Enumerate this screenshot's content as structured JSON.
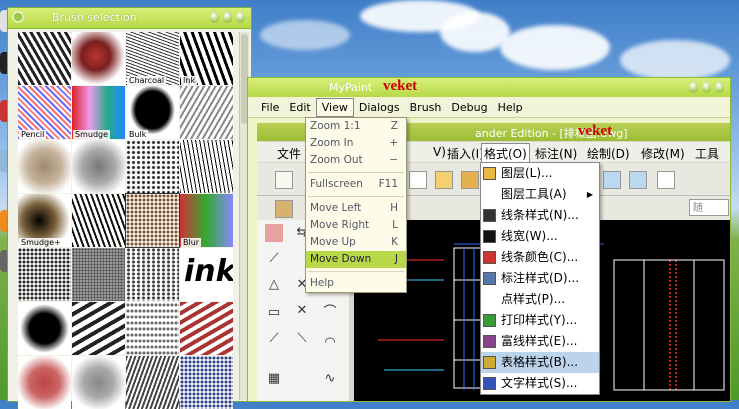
{
  "brush_window": {
    "title": "Brush selection",
    "brushes": [
      {
        "label": ""
      },
      {
        "label": ""
      },
      {
        "label": "Charcoal"
      },
      {
        "label": "Ink"
      },
      {
        "label": "Pencil"
      },
      {
        "label": "Smudge"
      },
      {
        "label": "Bulk"
      },
      {
        "label": ""
      },
      {
        "label": ""
      },
      {
        "label": ""
      },
      {
        "label": ""
      },
      {
        "label": ""
      },
      {
        "label": "Smudge+"
      },
      {
        "label": ""
      },
      {
        "label": ""
      },
      {
        "label": "Blur"
      },
      {
        "label": ""
      },
      {
        "label": ""
      },
      {
        "label": ""
      },
      {
        "label": ""
      },
      {
        "label": ""
      },
      {
        "label": ""
      },
      {
        "label": ""
      },
      {
        "label": ""
      },
      {
        "label": ""
      },
      {
        "label": ""
      },
      {
        "label": ""
      },
      {
        "label": ""
      }
    ],
    "ink_text": "ink",
    "accent": "#b6d946"
  },
  "mypaint": {
    "title": "MyPaint",
    "menu": [
      "File",
      "Edit",
      "View",
      "Dialogs",
      "Brush",
      "Debug",
      "Help"
    ],
    "active_menu": "View",
    "view_menu": [
      {
        "label": "Zoom 1:1",
        "key": "Z"
      },
      {
        "label": "Zoom In",
        "key": "+"
      },
      {
        "label": "Zoom Out",
        "key": "−"
      },
      {
        "sep": true
      },
      {
        "label": "Fullscreen",
        "key": "F11"
      },
      {
        "sep": true
      },
      {
        "label": "Move Left",
        "key": "H"
      },
      {
        "label": "Move Right",
        "key": "L"
      },
      {
        "label": "Move Up",
        "key": "K"
      },
      {
        "label": "Move Down",
        "key": "J",
        "highlighted": true
      },
      {
        "sep": true
      },
      {
        "label": "Help",
        "key": ""
      }
    ]
  },
  "watermark": "veket",
  "cad": {
    "title": "ander Edition - [排樣圖.dwg]",
    "menu": [
      "文件",
      "V)",
      "插入(I)",
      "格式(O)",
      "标注(N)",
      "绘制(D)",
      "修改(M)",
      "工具"
    ],
    "active_menu": "格式(O)",
    "format_menu": [
      {
        "label": "图层(L)...",
        "icon": "layers-icon"
      },
      {
        "label": "图层工具(A)",
        "icon": "",
        "submenu": true
      },
      {
        "label": "线条样式(N)...",
        "icon": "linestyle-icon"
      },
      {
        "label": "线宽(W)...",
        "icon": "lineweight-icon"
      },
      {
        "label": "线条颜色(C)...",
        "icon": "linecolor-icon"
      },
      {
        "label": "标注样式(D)...",
        "icon": "dimstyle-icon"
      },
      {
        "label": "点样式(P)...",
        "icon": ""
      },
      {
        "label": "打印样式(Y)...",
        "icon": "plotstyle-icon"
      },
      {
        "label": "富线样式(E)...",
        "icon": "mline-icon"
      },
      {
        "label": "表格样式(B)...",
        "icon": "tablestyle-icon",
        "highlighted": true
      },
      {
        "label": "文字样式(S)...",
        "icon": "textstyle-icon"
      }
    ],
    "toolbar_field_text": "随"
  }
}
